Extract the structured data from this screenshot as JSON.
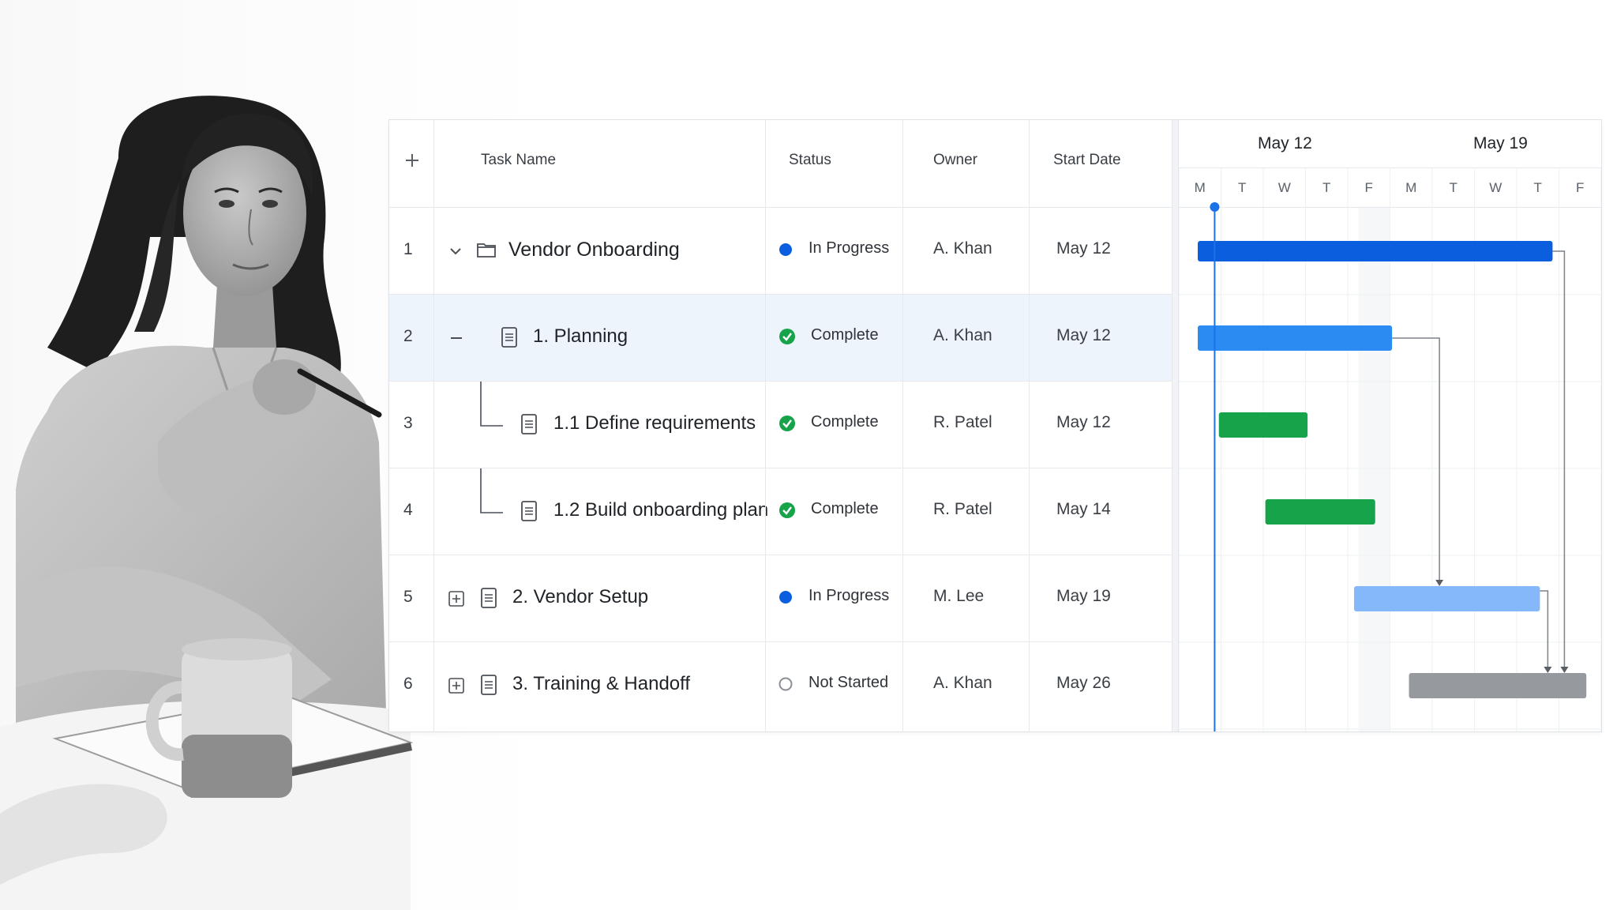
{
  "grid": {
    "headers": {
      "add": "+",
      "task_name": "Task Name",
      "status": "Status",
      "owner": "Owner",
      "start_date": "Start Date"
    },
    "rows": [
      {
        "num": "1",
        "task": "Vendor Onboarding",
        "status": "In Progress",
        "owner": "A. Khan",
        "start": "May 12"
      },
      {
        "num": "2",
        "task": "1. Planning",
        "status": "Complete",
        "owner": "A. Khan",
        "start": "May 12"
      },
      {
        "num": "3",
        "task": "1.1 Define requirements",
        "status": "Complete",
        "owner": "R. Patel",
        "start": "May 12"
      },
      {
        "num": "4",
        "task": "1.2 Build onboarding plan",
        "status": "Complete",
        "owner": "R. Patel",
        "start": "May 14"
      },
      {
        "num": "5",
        "task": "2. Vendor Setup",
        "status": "In Progress",
        "owner": "M. Lee",
        "start": "May 19"
      },
      {
        "num": "6",
        "task": "3. Training & Handoff",
        "status": "Not Started",
        "owner": "A. Khan",
        "start": "May 26"
      }
    ]
  },
  "timeline": {
    "weeks": [
      "May 12",
      "May 19"
    ],
    "days": [
      "M",
      "T",
      "W",
      "T",
      "F",
      "M",
      "T",
      "W",
      "T",
      "F"
    ],
    "bars": [
      {
        "row": 1,
        "start_day": 0,
        "end_day": 8.4,
        "color": "#0b5fdf"
      },
      {
        "row": 2,
        "start_day": 0,
        "end_day": 4.6,
        "color": "#2b8bf2"
      },
      {
        "row": 3,
        "start_day": 0.5,
        "end_day": 2.6,
        "color": "#16a34a"
      },
      {
        "row": 4,
        "start_day": 1.6,
        "end_day": 4.2,
        "color": "#16a34a"
      },
      {
        "row": 5,
        "start_day": 3.7,
        "end_day": 8.1,
        "color": "#84b8fb"
      },
      {
        "row": 6,
        "start_day": 5.0,
        "end_day": 9.2,
        "color": "#96999e"
      }
    ],
    "today_day": 0.4
  },
  "colors": {
    "accent": "#1a73e8",
    "complete": "#16a34a",
    "in_progress": "#0b5fdf",
    "not_started": "#8a8f96",
    "selected_row": "#eef4fc"
  }
}
